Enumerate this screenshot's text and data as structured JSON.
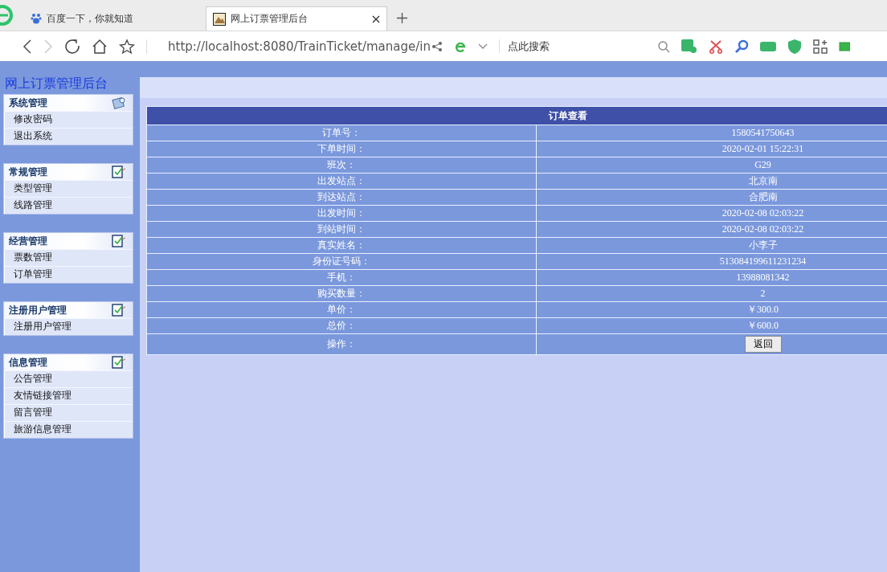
{
  "browser": {
    "tabs": [
      {
        "title": "百度一下，你就知道",
        "selected": false
      },
      {
        "title": "网上订票管理后台",
        "selected": true
      }
    ],
    "address": "http://localhost:8080/TrainTicket/manage/in",
    "search": {
      "placeholder": "点此搜索"
    }
  },
  "page": {
    "title": "网上订票管理后台",
    "sidebar": [
      {
        "title": "系统管理",
        "items": [
          "修改密码",
          "退出系统"
        ]
      },
      {
        "title": "常规管理",
        "items": [
          "类型管理",
          "线路管理"
        ]
      },
      {
        "title": "经营管理",
        "items": [
          "票数管理",
          "订单管理"
        ]
      },
      {
        "title": "注册用户管理",
        "items": [
          "注册用户管理"
        ]
      },
      {
        "title": "信息管理",
        "items": [
          "公告管理",
          "友情链接管理",
          "留言管理",
          "旅游信息管理"
        ]
      }
    ],
    "order": {
      "title": "订单查看",
      "rows": [
        {
          "label": "订单号：",
          "value": "1580541750643"
        },
        {
          "label": "下单时间：",
          "value": "2020-02-01 15:22:31"
        },
        {
          "label": "班次：",
          "value": "G29"
        },
        {
          "label": "出发站点：",
          "value": "北京南"
        },
        {
          "label": "到达站点：",
          "value": "合肥南"
        },
        {
          "label": "出发时间：",
          "value": "2020-02-08 02:03:22"
        },
        {
          "label": "到站时间：",
          "value": "2020-02-08 02:03:22"
        },
        {
          "label": "真实姓名：",
          "value": "小李子"
        },
        {
          "label": "身份证号码：",
          "value": "513084199611231234"
        },
        {
          "label": "手机：",
          "value": "13988081342"
        },
        {
          "label": "购买数量：",
          "value": "2"
        },
        {
          "label": "单价：",
          "value": "￥300.0"
        },
        {
          "label": "总价：",
          "value": "￥600.0"
        }
      ],
      "action_label": "操作：",
      "button": "返回"
    }
  }
}
